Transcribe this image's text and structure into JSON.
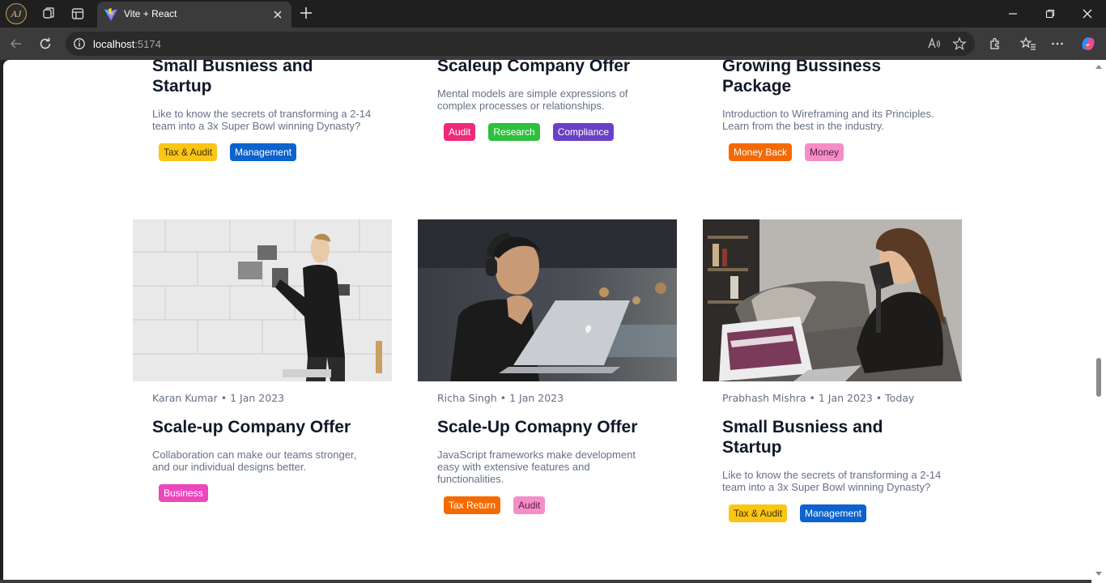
{
  "browser": {
    "profile_initials": "AJ",
    "tab_title": "Vite + React",
    "url_host": "localhost",
    "url_port": ":5174"
  },
  "colors": {
    "yellow": "#fac515",
    "blue": "#0b63ce",
    "pink": "#ee2a7b",
    "green": "#2fc03e",
    "purple": "#6941c6",
    "orange": "#f56a00",
    "lightpink": "#f58ec7",
    "magenta": "#ee46bc"
  },
  "top_cards": [
    {
      "title": "Small Busniess and Startup",
      "description": "Like to know the secrets of transforming a 2-14 team into a 3x Super Bowl winning Dynasty?",
      "tags": [
        {
          "label": "Tax & Audit",
          "color": "yellow"
        },
        {
          "label": "Management",
          "color": "blue"
        }
      ]
    },
    {
      "title": "Scaleup Company Offer",
      "description": "Mental models are simple expressions of complex processes or relationships.",
      "tags": [
        {
          "label": "Audit",
          "color": "pink"
        },
        {
          "label": "Research",
          "color": "green"
        },
        {
          "label": "Compliance",
          "color": "purple"
        }
      ]
    },
    {
      "title": "Growing Bussiness Package",
      "description": "Introduction to Wireframing and its Principles. Learn from the best in the industry.",
      "tags": [
        {
          "label": "Money Back",
          "color": "orange"
        },
        {
          "label": "Money",
          "color": "lightpink"
        }
      ]
    }
  ],
  "bottom_cards": [
    {
      "image": "man pinning photos on a white brick wall",
      "meta": "Karan Kumar • 1 Jan 2023",
      "title": "Scale-up Company Offer",
      "description": "Collaboration can make our teams stronger, and our individual designs better.",
      "tags": [
        {
          "label": "Business",
          "color": "magenta"
        }
      ]
    },
    {
      "image": "man with headphones looking at laptop",
      "meta": "Richa Singh • 1 Jan 2023",
      "title": "Scale-Up Comapny Offer",
      "description": "JavaScript frameworks make development easy with extensive features and functionalities.",
      "tags": [
        {
          "label": "Tax Return",
          "color": "orange"
        },
        {
          "label": "Audit",
          "color": "lightpink"
        }
      ]
    },
    {
      "image": "woman podcasting on a sofa with microphone and laptop",
      "meta": "Prabhash Mishra • 1 Jan 2023 • Today",
      "title": "Small Busniess and Startup",
      "description": "Like to know the secrets of transforming a 2-14 team into a 3x Super Bowl winning Dynasty?",
      "tags": [
        {
          "label": "Tax & Audit",
          "color": "yellow"
        },
        {
          "label": "Management",
          "color": "blue"
        }
      ]
    }
  ]
}
